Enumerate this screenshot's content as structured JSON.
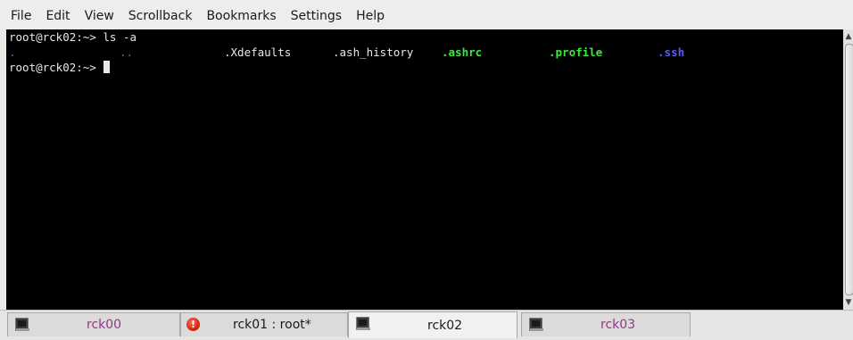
{
  "menu": {
    "items": [
      "File",
      "Edit",
      "View",
      "Scrollback",
      "Bookmarks",
      "Settings",
      "Help"
    ]
  },
  "terminal": {
    "line1": "root@rck02:~> ls -a",
    "ls_output": [
      {
        "name": ".",
        "color": "#5a5aff",
        "bold": false
      },
      {
        "name": "..",
        "color": "#5a5aff",
        "bold": false
      },
      {
        "name": ".Xdefaults",
        "color": "#e8e8e8",
        "bold": false
      },
      {
        "name": ".ash_history",
        "color": "#e8e8e8",
        "bold": false
      },
      {
        "name": ".ashrc",
        "color": "#3ee83e",
        "bold": true
      },
      {
        "name": ".profile",
        "color": "#3ee83e",
        "bold": true
      },
      {
        "name": ".ssh",
        "color": "#5a5aff",
        "bold": true
      }
    ],
    "prompt": "root@rck02:~> ",
    "background": "#000000",
    "foreground": "#e8e8e8"
  },
  "tabs": [
    {
      "label": "rck00",
      "icon": "terminal-icon",
      "color": "#8a3a8a",
      "active": false
    },
    {
      "label": "rck01 : root*",
      "icon": "alert-icon",
      "color": "#1a1a1a",
      "active": false
    },
    {
      "label": "rck02",
      "icon": "terminal-icon",
      "color": "#1a1a1a",
      "active": true
    },
    {
      "label": "rck03",
      "icon": "terminal-icon",
      "color": "#8a3a8a",
      "active": false
    }
  ]
}
